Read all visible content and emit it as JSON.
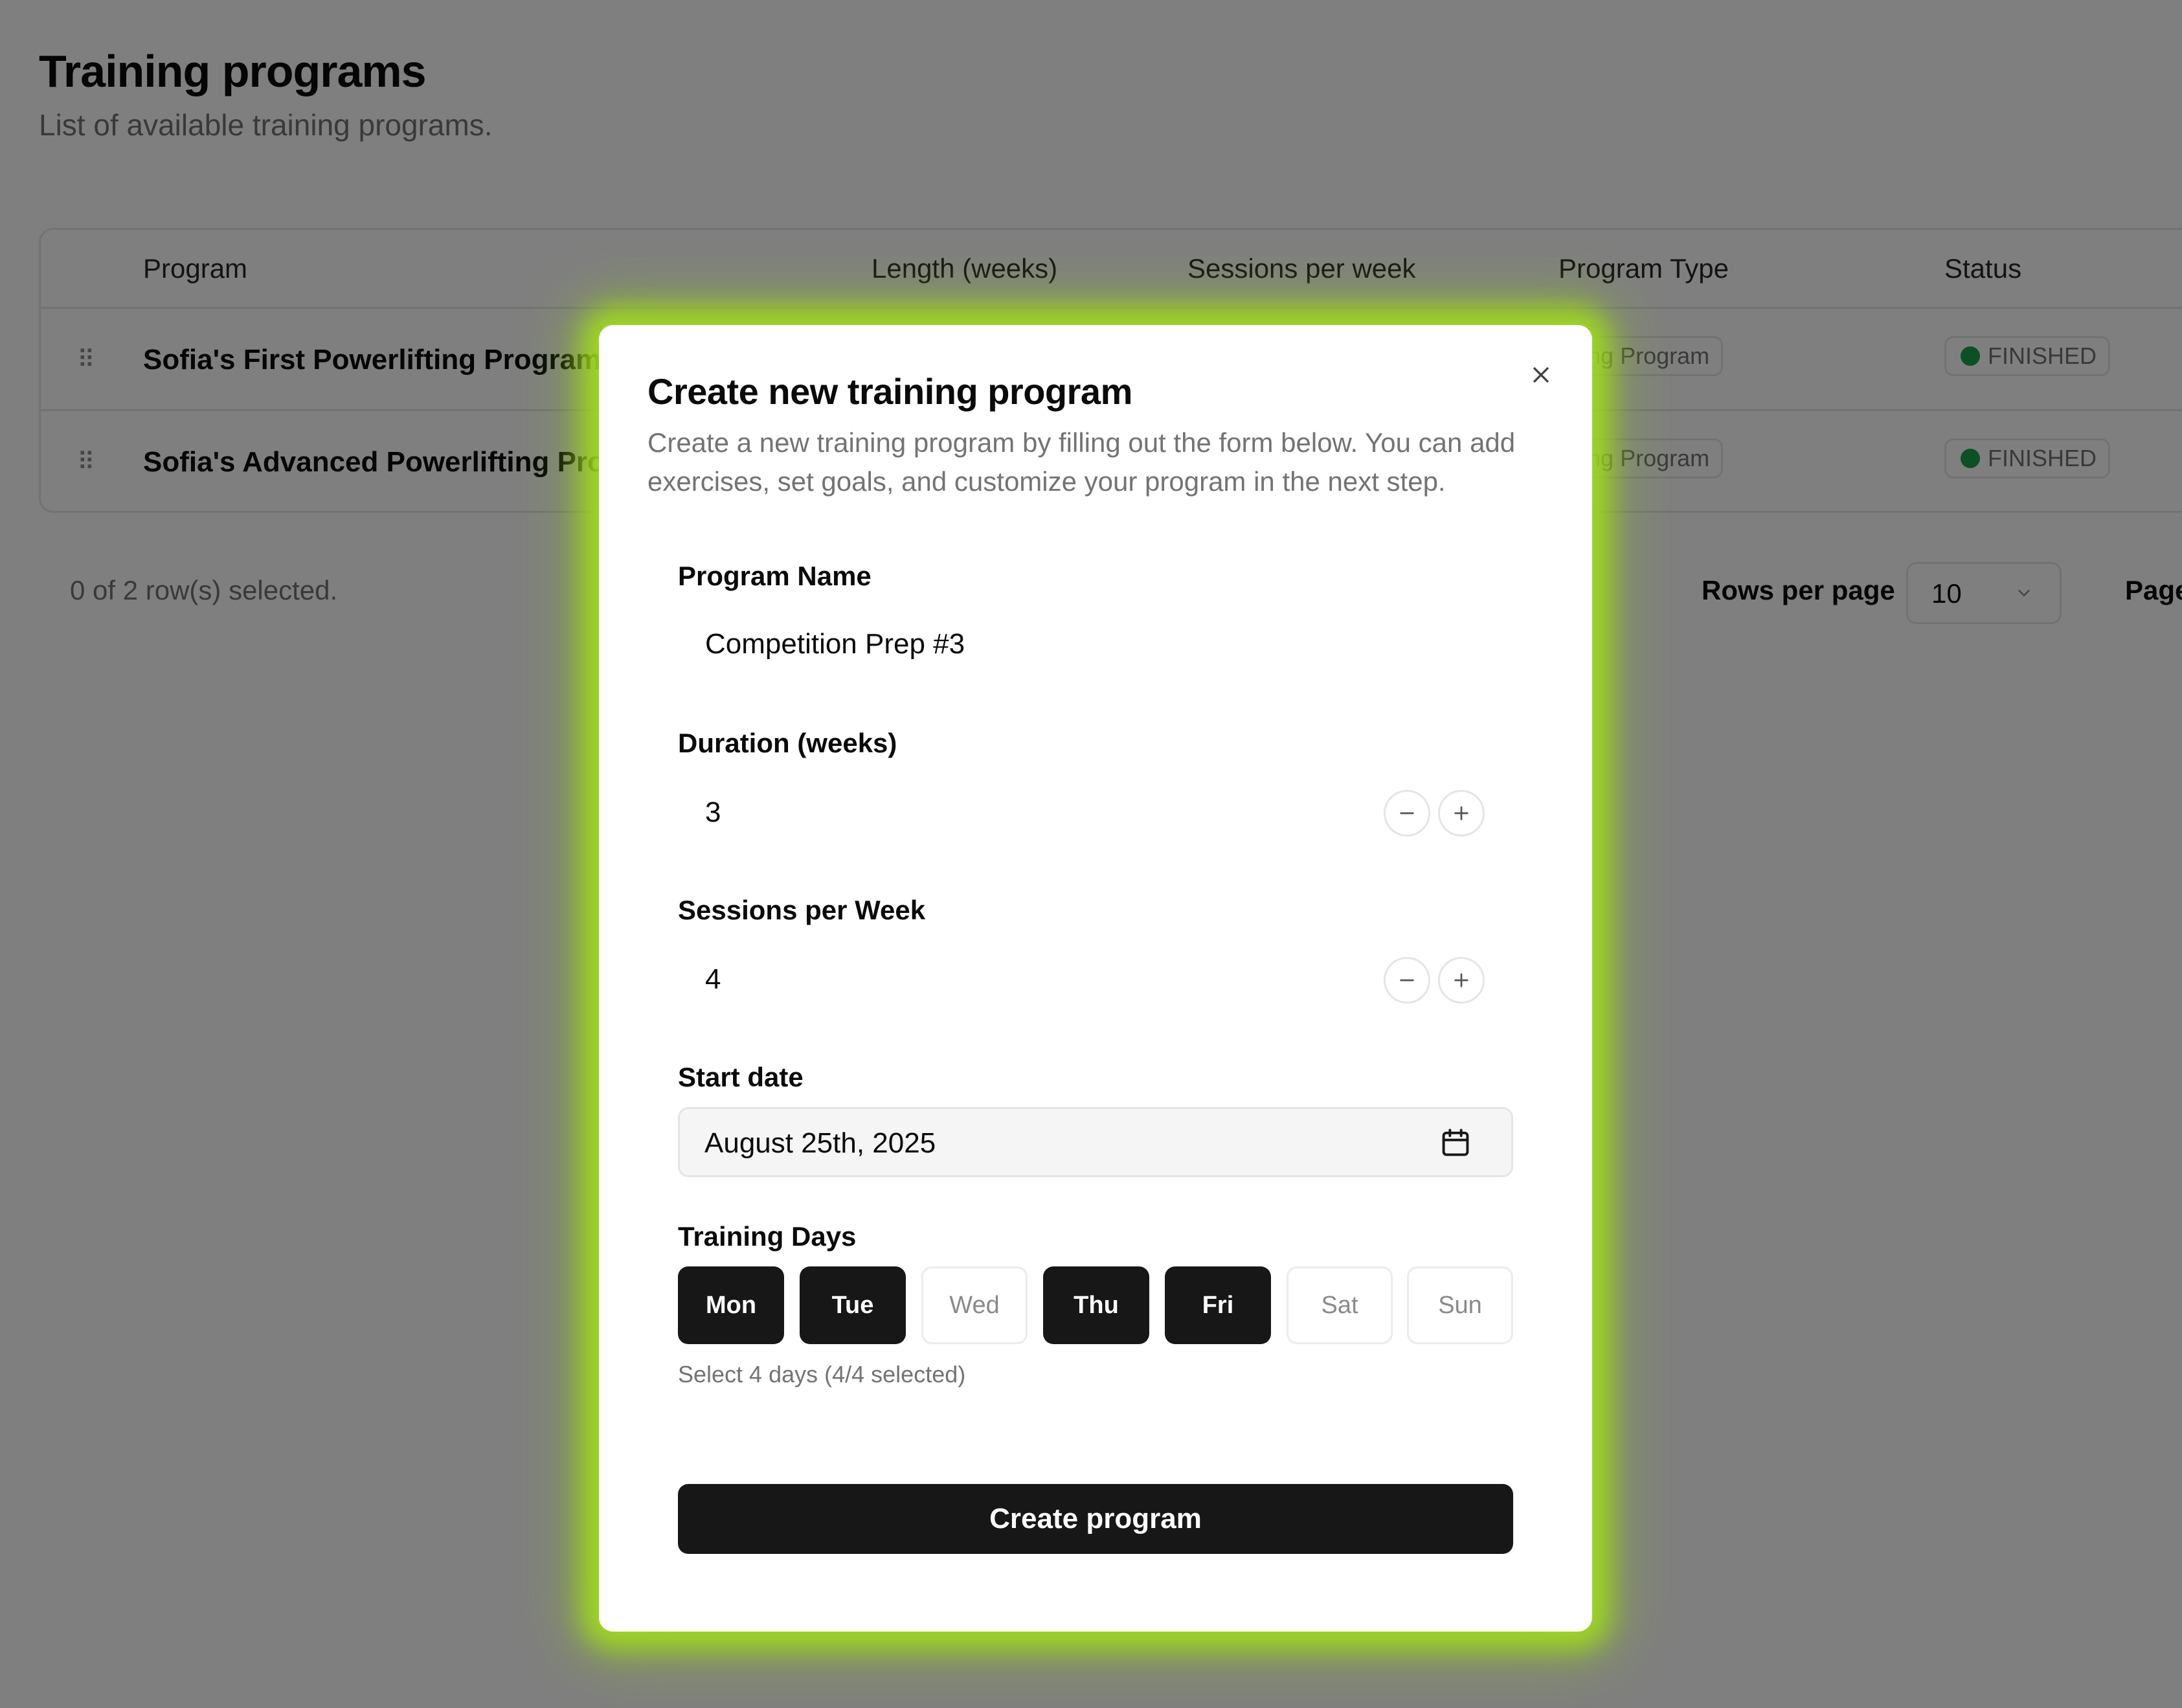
{
  "page": {
    "title": "Training programs",
    "subtitle": "List of available training programs."
  },
  "table": {
    "headers": [
      "Program",
      "Length (weeks)",
      "Sessions per week",
      "Program Type",
      "Status"
    ],
    "rows": [
      {
        "program": "Sofia's First Powerlifting Program",
        "type": "aining Program",
        "status": "FINISHED"
      },
      {
        "program": "Sofia's Advanced Powerlifting Progr",
        "type": "aining Program",
        "status": "FINISHED"
      }
    ]
  },
  "footer": {
    "selected_text": "0 of 2 row(s) selected.",
    "rows_per_page_label": "Rows per page",
    "rows_per_page_value": "10",
    "page_label": "Page"
  },
  "modal": {
    "title": "Create new training program",
    "description": "Create a new training program by filling out the form below. You can add exercises, set goals, and customize your program in the next step.",
    "program_name_label": "Program Name",
    "program_name_value": "Competition Prep #3",
    "duration_label": "Duration (weeks)",
    "duration_value": "3",
    "sessions_label": "Sessions per Week",
    "sessions_value": "4",
    "start_date_label": "Start date",
    "start_date_value": "August 25th, 2025",
    "training_days_label": "Training Days",
    "days": [
      {
        "label": "Mon",
        "selected": true
      },
      {
        "label": "Tue",
        "selected": true
      },
      {
        "label": "Wed",
        "selected": false
      },
      {
        "label": "Thu",
        "selected": true
      },
      {
        "label": "Fri",
        "selected": true
      },
      {
        "label": "Sat",
        "selected": false
      },
      {
        "label": "Sun",
        "selected": false
      }
    ],
    "days_hint": "Select 4 days (4/4 selected)",
    "submit_label": "Create program"
  },
  "colors": {
    "status_dot": "#16a34a",
    "primary_button": "#171717",
    "modal_glow": "#a0dc1e"
  },
  "icons": {
    "close": "close-icon",
    "minus": "minus-icon",
    "plus": "plus-icon",
    "calendar": "calendar-icon",
    "chevron": "chevron-down-icon",
    "drag": "drag-handle-icon"
  }
}
